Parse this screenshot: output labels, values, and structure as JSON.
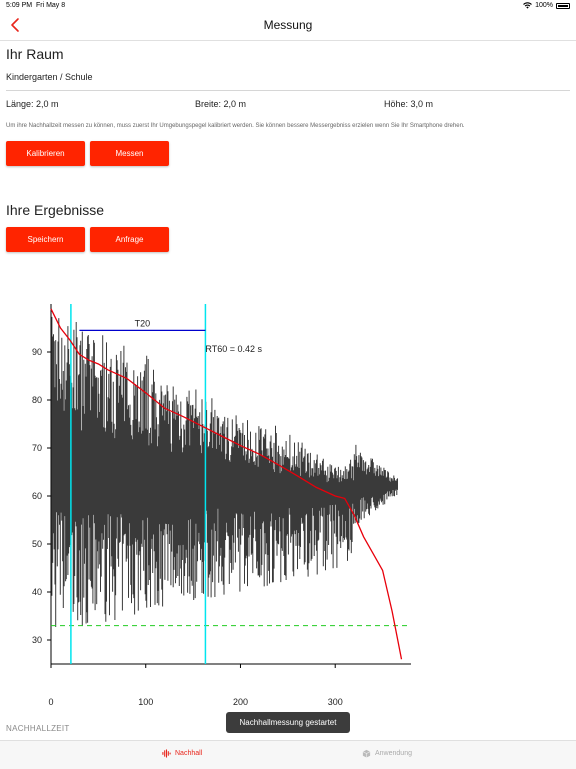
{
  "status": {
    "time": "5:09 PM",
    "date": "Fri May 8",
    "battery": "100%"
  },
  "nav": {
    "title": "Messung"
  },
  "room": {
    "heading": "Ihr Raum",
    "type": "Kindergarten / Schule",
    "length": "Länge: 2,0 m",
    "width": "Breite: 2,0 m",
    "height": "Höhe: 3,0 m",
    "hint": "Um ihre Nachhallzeit messen zu können, muss zuerst Ihr Umgebungspegel kalibriert werden. Sie können bessere Messergebniss erzielen wenn Sie Ihr Smartphone drehen."
  },
  "buttons": {
    "calibrate": "Kalibrieren",
    "measure": "Messen",
    "save": "Speichern",
    "request": "Anfrage"
  },
  "results": {
    "heading": "Ihre Ergebnisse"
  },
  "colors": {
    "accent": "#ff2400",
    "decay": "#e8000b",
    "marker": "#00e5ee",
    "t20": "#0000cc",
    "noise_floor": "#22cc22",
    "signal": "#3a3a3a"
  },
  "chart_data": {
    "type": "line",
    "title": "",
    "xlabel": "",
    "ylabel": "",
    "xlim": [
      0,
      380
    ],
    "ylim": [
      25,
      100
    ],
    "x_ticks": [
      "0",
      "100",
      "200",
      "300"
    ],
    "y_ticks": [
      "30",
      "40",
      "50",
      "60",
      "70",
      "80",
      "90"
    ],
    "annotations": {
      "t20_label": "T20",
      "rt60_label": "RT60 = 0.42 s"
    },
    "markers_x": [
      21,
      163
    ],
    "t20_line": {
      "x": [
        30,
        163
      ],
      "y": 94.5
    },
    "noise_floor_y": 33,
    "series": [
      {
        "x": [
          0,
          10,
          20,
          30,
          40,
          50,
          60,
          80,
          100,
          120,
          140,
          160,
          180,
          200,
          220,
          240,
          260,
          280,
          300,
          310,
          320,
          330,
          340,
          350,
          360,
          370
        ],
        "y": [
          99,
          95,
          92.5,
          89.5,
          88.3,
          87.5,
          86.3,
          84.5,
          81.5,
          78.3,
          76.5,
          74.5,
          72.5,
          70.5,
          68.7,
          66.5,
          64.2,
          61.8,
          60,
          59.5,
          56,
          51.5,
          48,
          44.5,
          36,
          26
        ]
      }
    ]
  },
  "footer": {
    "label": "NACHHALLZEIT",
    "toast": "Nachhallmessung gestartet"
  },
  "tabs": [
    {
      "label": "Nachhall",
      "icon": "waveform-icon",
      "active": true
    },
    {
      "label": "Anwendung",
      "icon": "box-icon",
      "active": false
    }
  ]
}
